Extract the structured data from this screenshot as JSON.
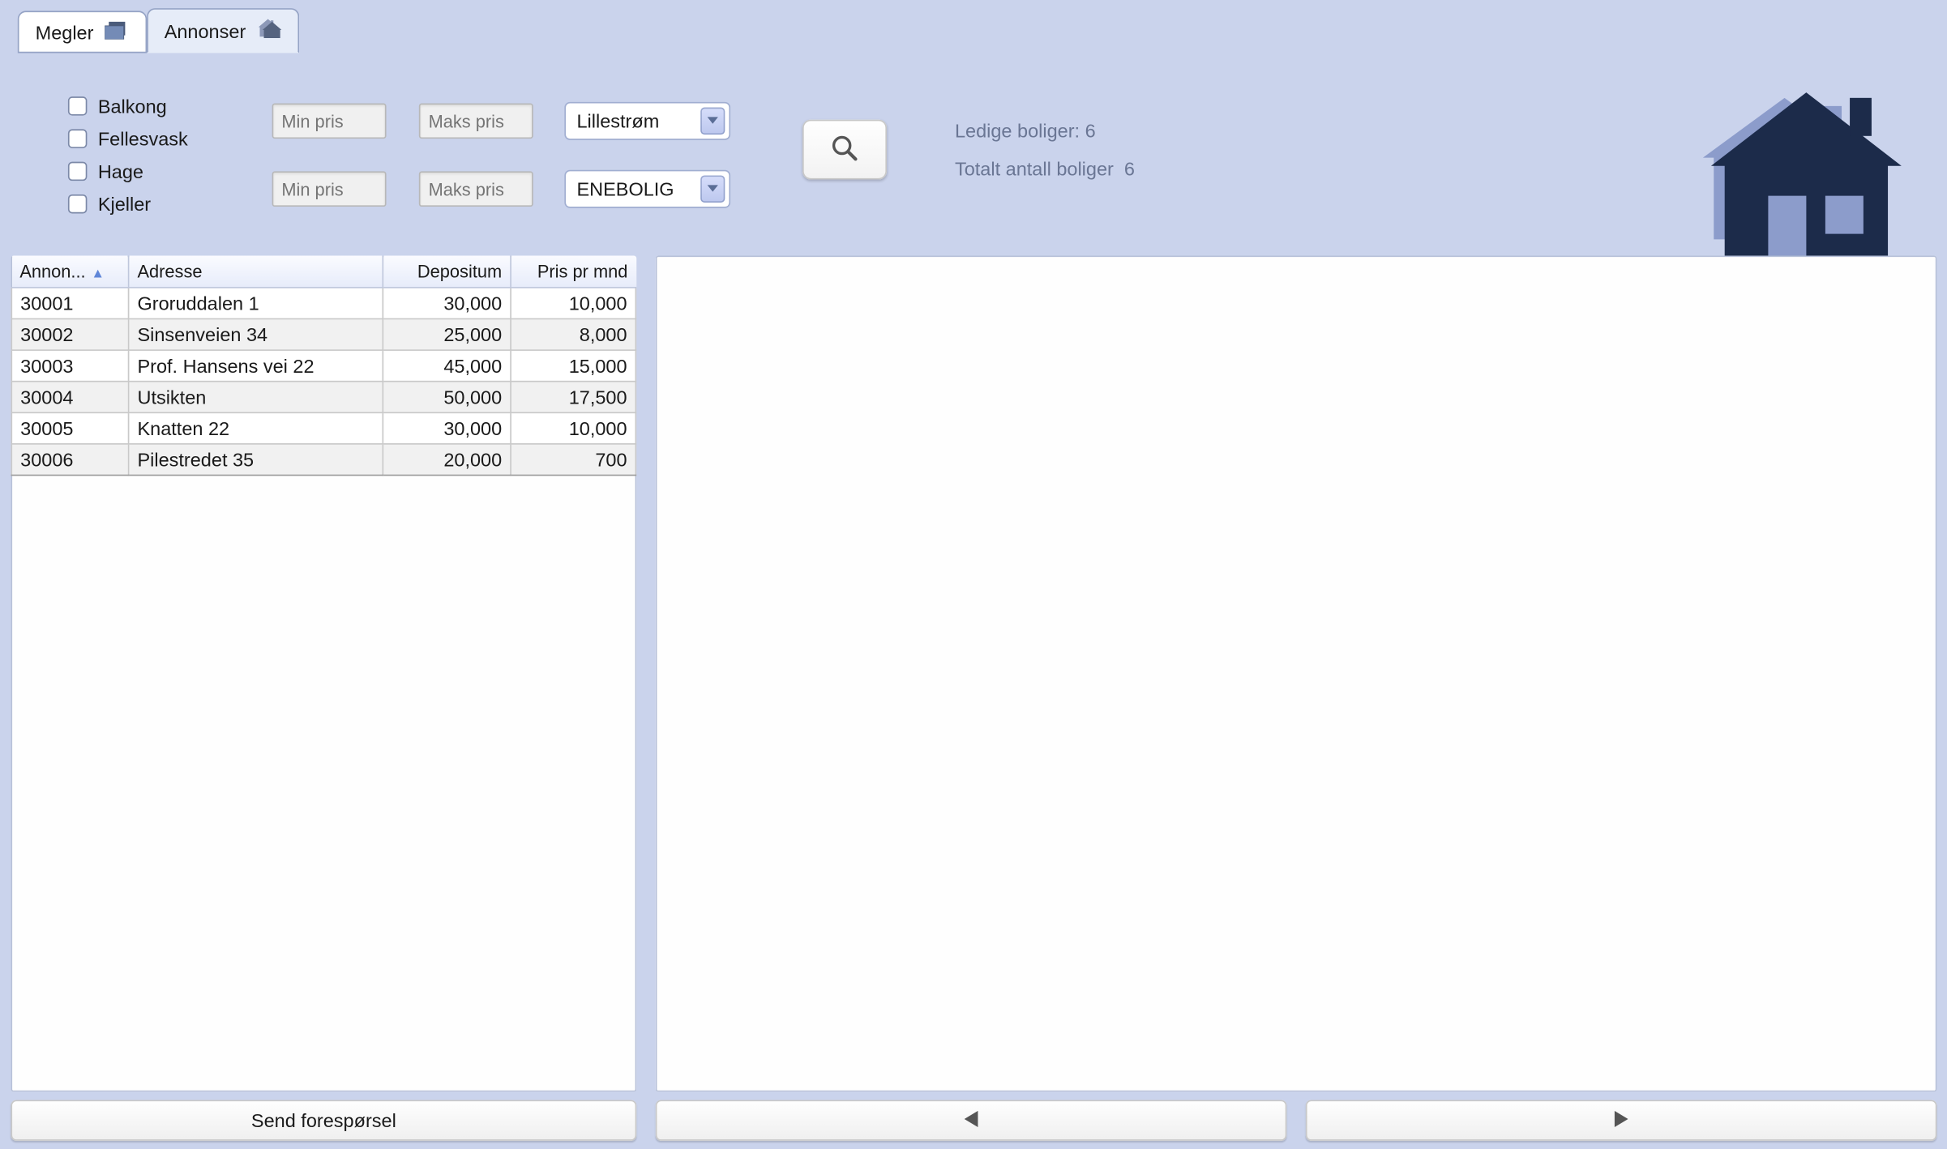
{
  "tabs": {
    "megler": "Megler",
    "annonser": "Annonser"
  },
  "filters": {
    "checks": {
      "balkong": "Balkong",
      "fellesvask": "Fellesvask",
      "hage": "Hage",
      "kjeller": "Kjeller"
    },
    "placeholders": {
      "min": "Min pris",
      "max": "Maks pris"
    },
    "combos": {
      "city": "Lillestrøm",
      "type": "ENEBOLIG"
    }
  },
  "stats": {
    "available_label": "Ledige boliger:",
    "available_value": "6",
    "total_label": "Totalt antall boliger",
    "total_value": "6"
  },
  "table": {
    "headers": {
      "id": "Annon...",
      "address": "Adresse",
      "deposit": "Depositum",
      "price": "Pris pr mnd"
    },
    "rows": [
      {
        "id": "30001",
        "address": "Groruddalen 1",
        "deposit": "30,000",
        "price": "10,000"
      },
      {
        "id": "30002",
        "address": "Sinsenveien 34",
        "deposit": "25,000",
        "price": "8,000"
      },
      {
        "id": "30003",
        "address": "Prof. Hansens vei 22",
        "deposit": "45,000",
        "price": "15,000"
      },
      {
        "id": "30004",
        "address": "Utsikten",
        "deposit": "50,000",
        "price": "17,500"
      },
      {
        "id": "30005",
        "address": "Knatten 22",
        "deposit": "30,000",
        "price": "10,000"
      },
      {
        "id": "30006",
        "address": "Pilestredet 35",
        "deposit": "20,000",
        "price": "700"
      }
    ]
  },
  "buttons": {
    "send": "Send forespørsel"
  }
}
